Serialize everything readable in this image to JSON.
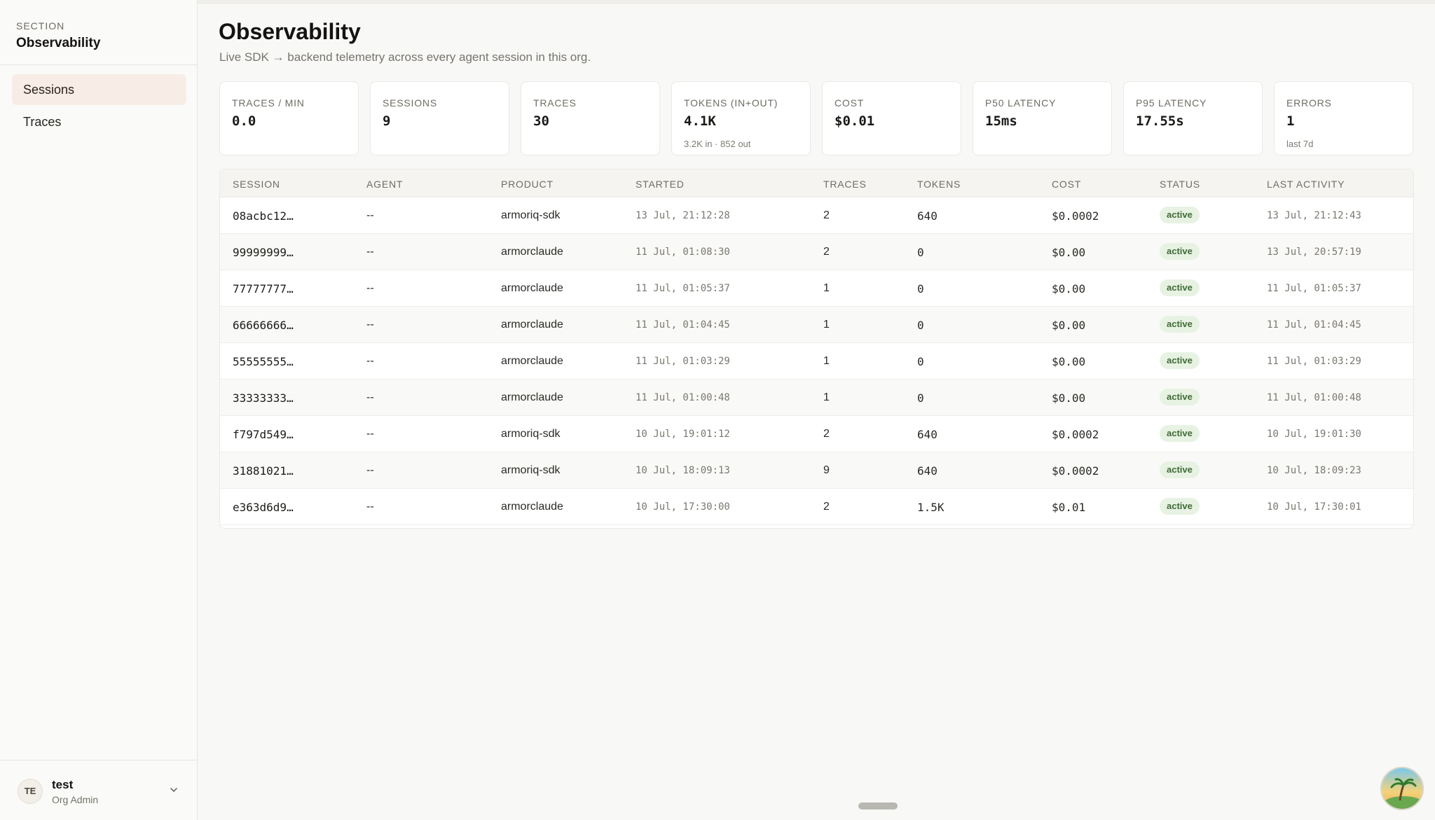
{
  "sidebar": {
    "section_label": "SECTION",
    "section_title": "Observability",
    "items": [
      {
        "label": "Sessions",
        "active": true
      },
      {
        "label": "Traces",
        "active": false
      }
    ],
    "user": {
      "initials": "TE",
      "name": "test",
      "role": "Org Admin"
    }
  },
  "page": {
    "title": "Observability",
    "subtitle": "Live SDK → backend telemetry across every agent session in this org."
  },
  "stats": [
    {
      "label": "TRACES / MIN",
      "value": "0.0",
      "sub": ""
    },
    {
      "label": "SESSIONS",
      "value": "9",
      "sub": ""
    },
    {
      "label": "TRACES",
      "value": "30",
      "sub": ""
    },
    {
      "label": "TOKENS (IN+OUT)",
      "value": "4.1K",
      "sub": "3.2K in · 852 out"
    },
    {
      "label": "COST",
      "value": "$0.01",
      "sub": ""
    },
    {
      "label": "P50 LATENCY",
      "value": "15ms",
      "sub": ""
    },
    {
      "label": "P95 LATENCY",
      "value": "17.55s",
      "sub": ""
    },
    {
      "label": "ERRORS",
      "value": "1",
      "sub": "last 7d"
    }
  ],
  "table": {
    "columns": [
      "SESSION",
      "AGENT",
      "PRODUCT",
      "STARTED",
      "TRACES",
      "TOKENS",
      "COST",
      "STATUS",
      "LAST ACTIVITY"
    ],
    "rows": [
      {
        "session": "08acbc12…",
        "agent": "--",
        "product": "armoriq-sdk",
        "started": "13 Jul, 21:12:28",
        "traces": "2",
        "tokens": "640",
        "cost": "$0.0002",
        "status": "active",
        "last": "13 Jul, 21:12:43"
      },
      {
        "session": "99999999…",
        "agent": "--",
        "product": "armorclaude",
        "started": "11 Jul, 01:08:30",
        "traces": "2",
        "tokens": "0",
        "cost": "$0.00",
        "status": "active",
        "last": "13 Jul, 20:57:19"
      },
      {
        "session": "77777777…",
        "agent": "--",
        "product": "armorclaude",
        "started": "11 Jul, 01:05:37",
        "traces": "1",
        "tokens": "0",
        "cost": "$0.00",
        "status": "active",
        "last": "11 Jul, 01:05:37"
      },
      {
        "session": "66666666…",
        "agent": "--",
        "product": "armorclaude",
        "started": "11 Jul, 01:04:45",
        "traces": "1",
        "tokens": "0",
        "cost": "$0.00",
        "status": "active",
        "last": "11 Jul, 01:04:45"
      },
      {
        "session": "55555555…",
        "agent": "--",
        "product": "armorclaude",
        "started": "11 Jul, 01:03:29",
        "traces": "1",
        "tokens": "0",
        "cost": "$0.00",
        "status": "active",
        "last": "11 Jul, 01:03:29"
      },
      {
        "session": "33333333…",
        "agent": "--",
        "product": "armorclaude",
        "started": "11 Jul, 01:00:48",
        "traces": "1",
        "tokens": "0",
        "cost": "$0.00",
        "status": "active",
        "last": "11 Jul, 01:00:48"
      },
      {
        "session": "f797d549…",
        "agent": "--",
        "product": "armoriq-sdk",
        "started": "10 Jul, 19:01:12",
        "traces": "2",
        "tokens": "640",
        "cost": "$0.0002",
        "status": "active",
        "last": "10 Jul, 19:01:30"
      },
      {
        "session": "31881021…",
        "agent": "--",
        "product": "armoriq-sdk",
        "started": "10 Jul, 18:09:13",
        "traces": "9",
        "tokens": "640",
        "cost": "$0.0002",
        "status": "active",
        "last": "10 Jul, 18:09:23"
      },
      {
        "session": "e363d6d9…",
        "agent": "--",
        "product": "armorclaude",
        "started": "10 Jul, 17:30:00",
        "traces": "2",
        "tokens": "1.5K",
        "cost": "$0.01",
        "status": "active",
        "last": "10 Jul, 17:30:01"
      }
    ]
  },
  "colors": {
    "accent_active_bg": "#f8ede6",
    "status_active_bg": "#e7f2e3",
    "status_active_fg": "#3e6b35"
  },
  "icons": {
    "user_menu": "chevron-down-icon",
    "corner": "assistant-avatar-icon"
  }
}
